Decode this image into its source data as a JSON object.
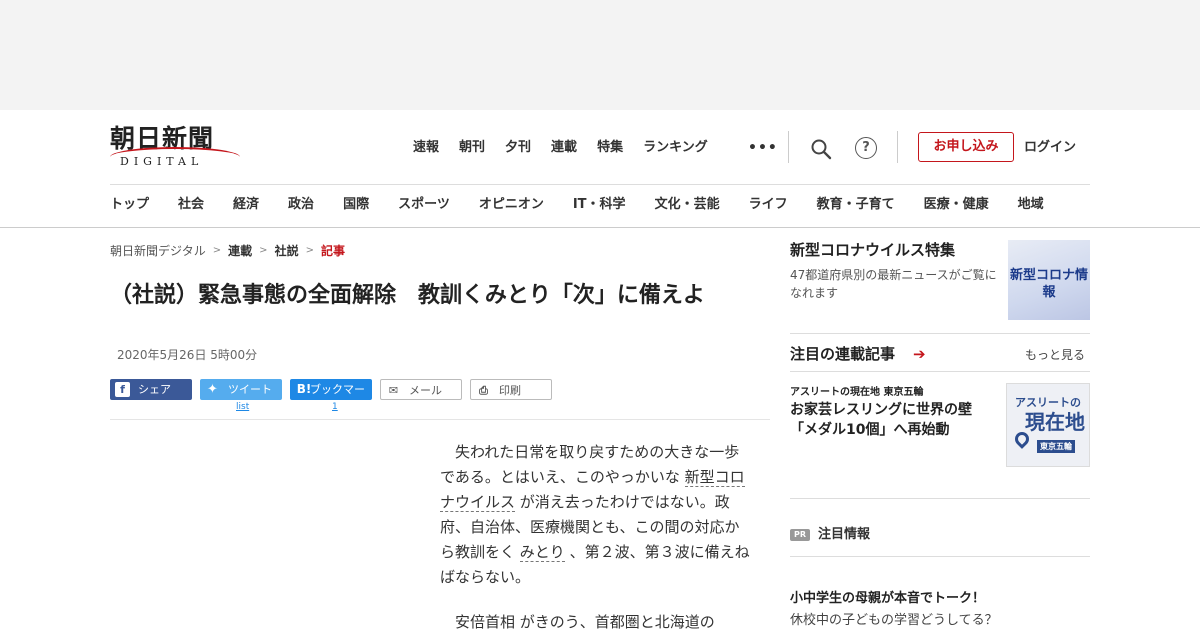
{
  "header": {
    "logo_main": "朝日新聞",
    "logo_sub": "DIGITAL",
    "primary_nav": [
      "速報",
      "朝刊",
      "夕刊",
      "連載",
      "特集",
      "ランキング"
    ],
    "more": "•••",
    "help": "?",
    "subscribe_label": "お申し込み",
    "login_label": "ログイン"
  },
  "section_nav": [
    "トップ",
    "社会",
    "経済",
    "政治",
    "国際",
    "スポーツ",
    "オピニオン",
    "IT・科学",
    "文化・芸能",
    "ライフ",
    "教育・子育て",
    "医療・健康",
    "地域"
  ],
  "breadcrumb": [
    "朝日新聞デジタル",
    "連載",
    "社説",
    "記事"
  ],
  "article": {
    "headline": "（社説）緊急事態の全面解除　教訓くみとり「次」に備えよ",
    "date": "2020年5月26日 5時00分",
    "share": {
      "facebook": "シェア",
      "twitter": "ツイート",
      "twitter_count": "list",
      "hatena": "ブックマーク",
      "hatena_count": "1",
      "mail": "メール",
      "print": "印刷"
    },
    "p1_a": "失われた日常を取り戻すための大きな一歩である。とはいえ、このやっかいな ",
    "p1_kw1": "新型コロナウイルス",
    "p1_b": " が消え去ったわけではない。政府、自治体、医療機関とも、この間の対応から教訓をく ",
    "p1_kw2": "みとり",
    "p1_c": " 、第２波、第３波に備えねばならない。",
    "p2_kw": "安倍首相",
    "p2_a": " がきのう、首都圏と北海道の"
  },
  "sidebar": {
    "covid_title": "新型コロナウイルス特集",
    "covid_desc": "47都道府県別の最新ニュースがご覧になれます",
    "covid_thumb": "新型コロナ情報",
    "series_title": "注目の連載記事",
    "series_arrow": "➔",
    "see_more": "もっと見る",
    "article_kicker": "アスリートの現在地 東京五輪",
    "article_title": "お家芸レスリングに世界の壁「メダル10個」へ再始動",
    "thumb_line1": "アスリートの",
    "thumb_line2": "現在地",
    "thumb_line3": "東京五輪",
    "pr_badge": "PR",
    "pr_title": "注目情報",
    "pr_item_title": "小中学生の母親が本音でトーク！",
    "pr_item_sub": "休校中の子どもの学習どうしてる？"
  },
  "colors": {
    "brand_red": "#c4161c",
    "facebook": "#3b5998",
    "twitter": "#55acee",
    "hatena": "#1e88e5"
  }
}
